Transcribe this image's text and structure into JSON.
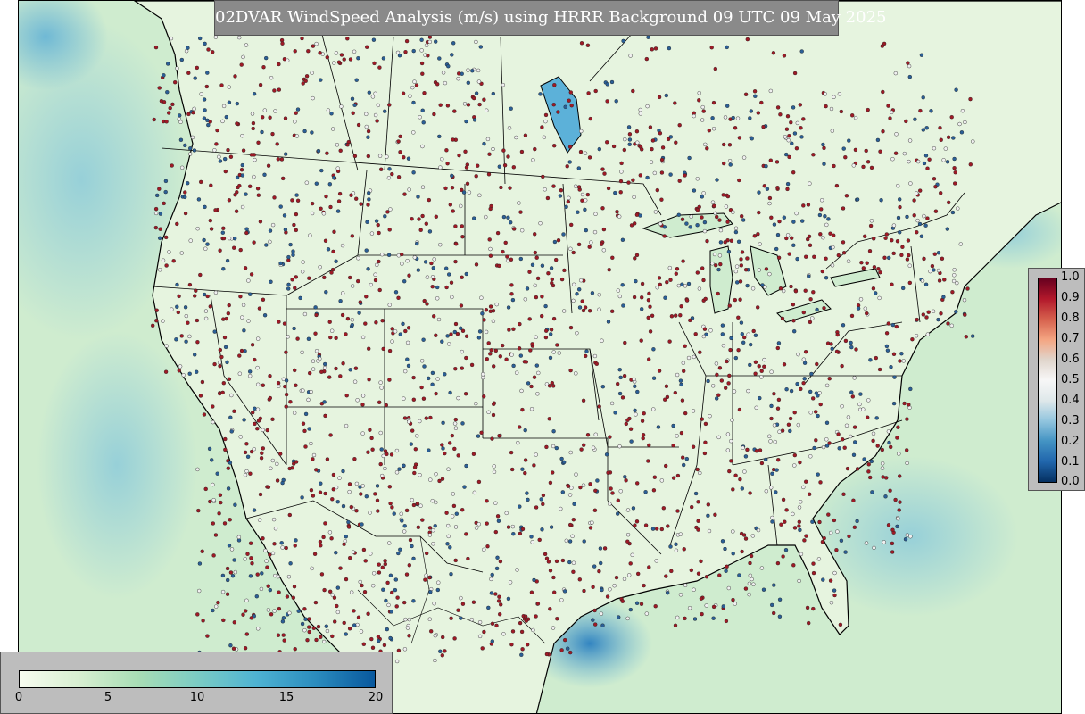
{
  "title": "02DVAR WindSpeed Analysis (m/s) using HRRR Background 09 UTC 09 May 2025",
  "colors": {
    "land": "#dff2d9",
    "land_light": "#f1f9ec",
    "ocean": "#cdecd0",
    "water_blue": "#4a9fcf",
    "water_dark": "#2f78b8",
    "border_line": "#000000",
    "dot_red": "#9e1a26",
    "dot_blue": "#2b5f96",
    "dot_white": "#f0f0f0"
  },
  "observation_legend": {
    "ticks": [
      "1.0",
      "0.9",
      "0.8",
      "0.7",
      "0.6",
      "0.5",
      "0.4",
      "0.3",
      "0.2",
      "0.1",
      "0.0"
    ],
    "colors": [
      "#67001f",
      "#b2182b",
      "#d6604d",
      "#f4a582",
      "#e0d5cc",
      "#f7f7f7",
      "#dfe8ea",
      "#92c5de",
      "#4393c3",
      "#2166ac",
      "#053061"
    ]
  },
  "windspeed_legend": {
    "ticks": [
      "0",
      "5",
      "10",
      "15",
      "20"
    ],
    "colors": [
      "#f7fcf0",
      "#d7efd1",
      "#a8ddb5",
      "#7bccc4",
      "#4eb3d3",
      "#2b8cbe",
      "#08589e"
    ]
  }
}
